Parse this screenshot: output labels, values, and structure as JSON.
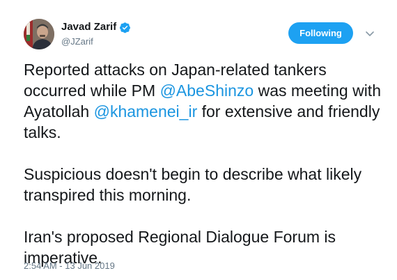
{
  "author": {
    "display_name": "Javad Zarif",
    "handle": "@JZarif",
    "verified_icon": "verified-badge-icon"
  },
  "follow_button": {
    "label": "Following"
  },
  "menu": {
    "icon": "chevron-down-icon"
  },
  "tweet": {
    "p1_a": "Reported attacks on Japan-related tankers occurred while PM ",
    "mention_1": "@AbeShinzo",
    "p1_b": " was meeting with Ayatollah ",
    "mention_2": "@khamenei_ir",
    "p1_c": " for extensive and friendly talks.",
    "p2": "Suspicious doesn't begin to describe what likely transpired this morning.",
    "p3": "Iran's proposed Regional Dialogue Forum is imperative."
  },
  "timestamp": "2:54 AM - 13 Jun 2019",
  "colors": {
    "accent": "#1da1f2",
    "link": "#1b95e0",
    "text": "#14171a",
    "muted": "#657786"
  }
}
